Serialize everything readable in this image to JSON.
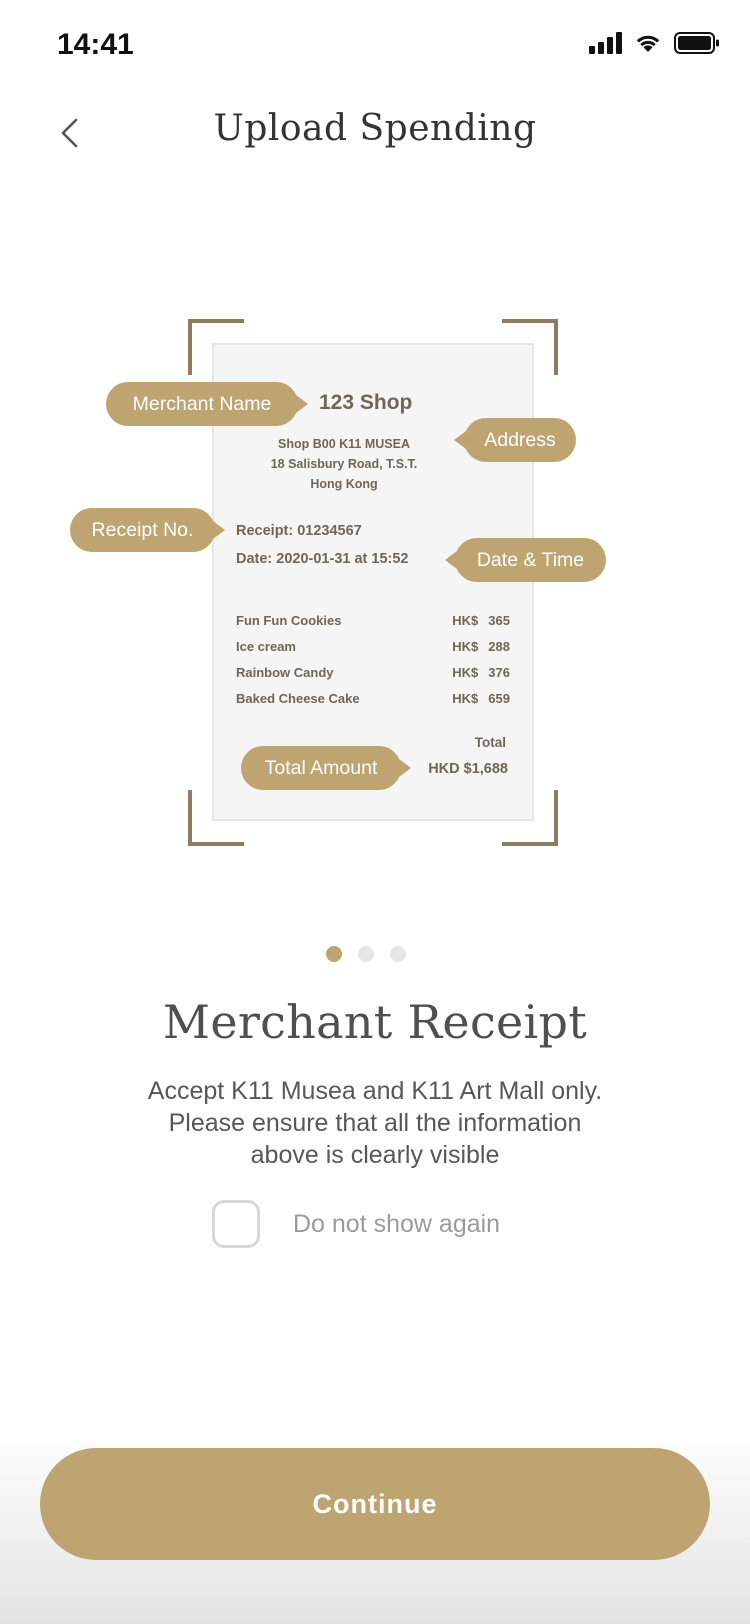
{
  "status_bar": {
    "time": "14:41"
  },
  "nav": {
    "title": "Upload Spending"
  },
  "receipt": {
    "shop": "123 Shop",
    "address": [
      "Shop B00 K11 MUSEA",
      "18 Salisbury Road, T.S.T.",
      "Hong Kong"
    ],
    "receipt_no": "Receipt: 01234567",
    "date": "Date: 2020-01-31 at 15:52",
    "items": [
      {
        "name": "Fun Fun Cookies",
        "currency": "HK$",
        "amount": "365"
      },
      {
        "name": "Ice cream",
        "currency": "HK$",
        "amount": "288"
      },
      {
        "name": "Rainbow Candy",
        "currency": "HK$",
        "amount": "376"
      },
      {
        "name": "Baked Cheese Cake",
        "currency": "HK$",
        "amount": "659"
      }
    ],
    "total_label": "Total",
    "total": "HKD $1,688"
  },
  "tags": {
    "merchant_name": "Merchant Name",
    "address": "Address",
    "receipt_no": "Receipt No.",
    "date_time": "Date & Time",
    "total_amount": "Total Amount"
  },
  "pager": {
    "count": 3,
    "active": 1
  },
  "content": {
    "heading": "Merchant Receipt",
    "description": [
      "Accept K11 Musea and K11 Art Mall only.",
      "Please ensure that all the information",
      "above is clearly visible"
    ],
    "checkbox_label": "Do not show again",
    "checkbox_checked": false
  },
  "footer": {
    "continue_label": "Continue"
  },
  "colors": {
    "accent": "#bea470",
    "frame": "#8e7b62",
    "receipt_bg": "#f5f5f5"
  },
  "icons": {
    "back": "chevron-left-icon",
    "signal": "cellular-signal-icon",
    "wifi": "wifi-icon",
    "battery": "battery-icon"
  }
}
